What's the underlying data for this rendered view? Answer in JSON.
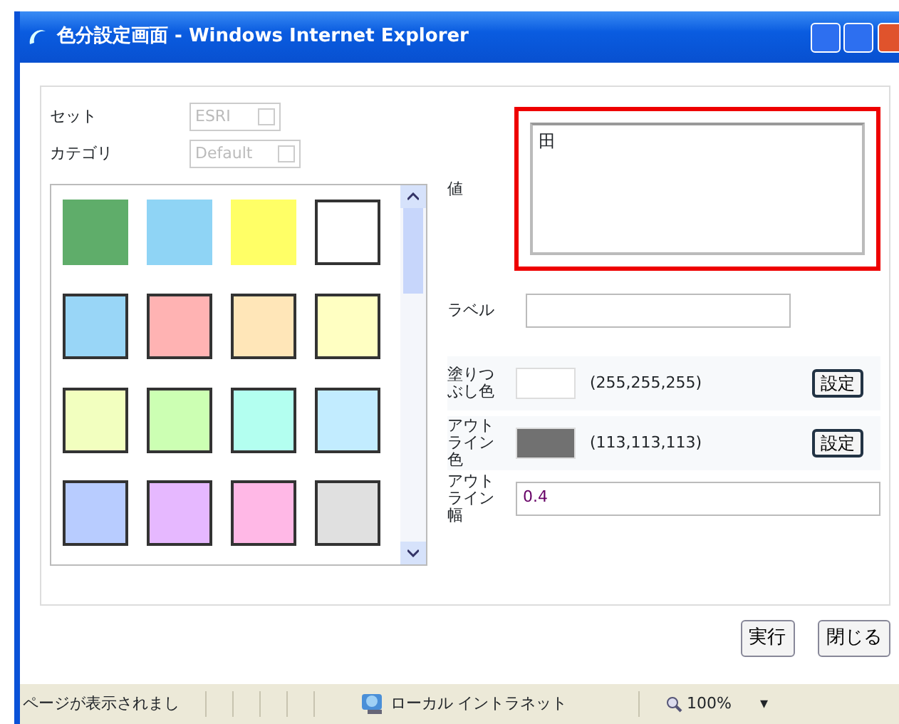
{
  "window": {
    "title": "色分設定画面 - Windows Internet Explorer"
  },
  "set": {
    "label": "セット",
    "value": "ESRI",
    "disabled": true
  },
  "category": {
    "label": "カテゴリ",
    "value": "Default",
    "disabled": true
  },
  "swatches": [
    {
      "color": "#5fad6a",
      "outlined": false
    },
    {
      "color": "#8fd4f5",
      "outlined": false
    },
    {
      "color": "#ffff66",
      "outlined": false
    },
    {
      "color": "#ffffff",
      "outlined": true
    },
    {
      "color": "#99d6f7",
      "outlined": true
    },
    {
      "color": "#ffb3b3",
      "outlined": true
    },
    {
      "color": "#ffe6b8",
      "outlined": true
    },
    {
      "color": "#ffffc2",
      "outlined": true
    },
    {
      "color": "#f2ffbf",
      "outlined": true
    },
    {
      "color": "#ccffb3",
      "outlined": true
    },
    {
      "color": "#b3fff0",
      "outlined": true
    },
    {
      "color": "#c2ecff",
      "outlined": true
    },
    {
      "color": "#b8ccff",
      "outlined": true
    },
    {
      "color": "#e6b8ff",
      "outlined": true
    },
    {
      "color": "#ffb8e6",
      "outlined": true
    },
    {
      "color": "#e0e0e0",
      "outlined": true
    }
  ],
  "value_field": {
    "label": "値",
    "content": "田",
    "highlighted": true
  },
  "label_field": {
    "label": "ラベル"
  },
  "fill_color": {
    "label": "塗りつぶし色",
    "color": "#ffffff",
    "rgb": "(255,255,255)",
    "button": "設定"
  },
  "outline_color": {
    "label": "アウトライン色",
    "color": "#717171",
    "rgb": "(113,113,113)",
    "button": "設定"
  },
  "outline_width": {
    "label": "アウトライン幅",
    "value": "0.4"
  },
  "buttons": [
    "実行",
    "閉じる"
  ],
  "status_bar": {
    "message": "ページが表示されまし",
    "zone": "ローカル イントラネット",
    "zoom": "100%",
    "zoom_menu": "▾"
  }
}
